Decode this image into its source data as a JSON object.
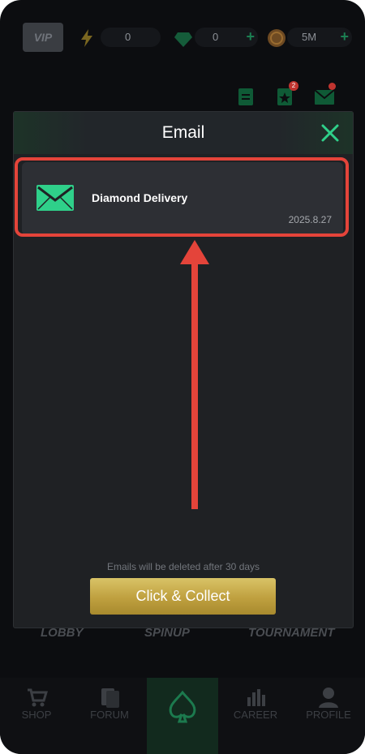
{
  "topbar": {
    "vip_label": "VIP",
    "energy_value": "0",
    "gems_value": "0",
    "coins_value": "5M",
    "plus_symbol": "+",
    "rewards_badge": "2"
  },
  "modal": {
    "title": "Email",
    "emails": [
      {
        "subject": "Diamond Delivery",
        "date": "2025.8.27"
      }
    ],
    "notice": "Emails will be deleted after 30 days",
    "collect_button": "Click & Collect"
  },
  "lobby_tiles": {
    "lobby": "LOBBY",
    "spinup": "SPINUP",
    "tournament": "TOURNAMENT"
  },
  "bottom_nav": {
    "items": [
      {
        "label": "SHOP"
      },
      {
        "label": "FORUM"
      },
      {
        "label": ""
      },
      {
        "label": "CAREER"
      },
      {
        "label": "PROFILE"
      }
    ]
  },
  "colors": {
    "accent_green": "#2fd08a",
    "highlight_red": "#e4443a",
    "button_gold": "#c9ac4c"
  },
  "icons": [
    "lightning-icon",
    "gem-icon",
    "coin-icon",
    "tasks-icon",
    "rewards-icon",
    "mail-icon",
    "close-icon",
    "envelope-icon",
    "shop-icon",
    "forum-icon",
    "spade-icon",
    "career-icon",
    "profile-icon"
  ]
}
